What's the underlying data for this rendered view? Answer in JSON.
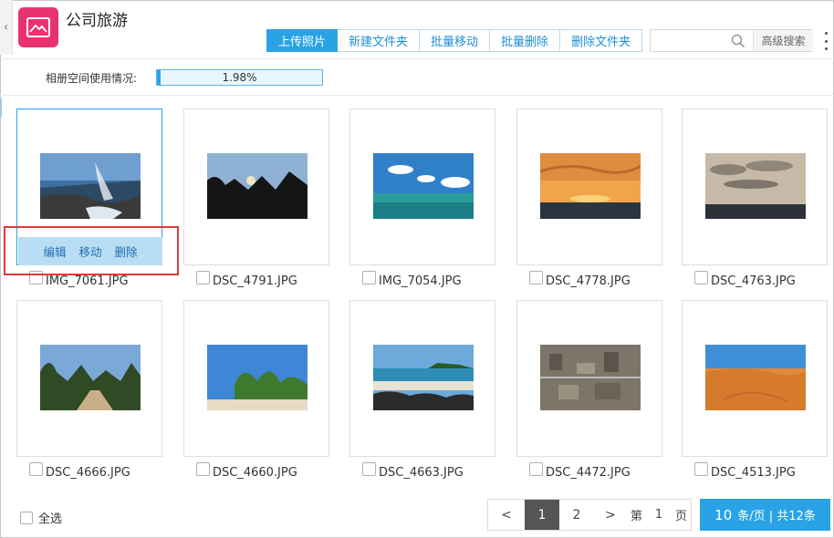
{
  "app": {
    "title": "公司旅游"
  },
  "toolbar": {
    "upload": "上传照片",
    "new_folder": "新建文件夹",
    "batch_move": "批量移动",
    "batch_delete": "批量删除",
    "delete_folder": "删除文件夹"
  },
  "search": {
    "placeholder": "",
    "advanced": "高级搜索"
  },
  "quota": {
    "label": "相册空间使用情况:",
    "percent_text": "1.98%",
    "percent_value": 1.98
  },
  "photo_actions": {
    "edit": "编辑",
    "move": "移动",
    "delete": "删除"
  },
  "photos": [
    {
      "name": "IMG_7061.JPG",
      "scene": "coast-waves"
    },
    {
      "name": "DSC_4791.JPG",
      "scene": "palm-sunset"
    },
    {
      "name": "IMG_7054.JPG",
      "scene": "sea-sky"
    },
    {
      "name": "DSC_4778.JPG",
      "scene": "orange-sunset"
    },
    {
      "name": "DSC_4763.JPG",
      "scene": "cloudy-dusk"
    },
    {
      "name": "DSC_4666.JPG",
      "scene": "palm-path"
    },
    {
      "name": "DSC_4660.JPG",
      "scene": "palm-blue"
    },
    {
      "name": "DSC_4663.JPG",
      "scene": "rocky-beach"
    },
    {
      "name": "DSC_4472.JPG",
      "scene": "city-aerial"
    },
    {
      "name": "DSC_4513.JPG",
      "scene": "desert"
    }
  ],
  "footer": {
    "select_all": "全选"
  },
  "pagination": {
    "prev": "<",
    "pages": [
      "1",
      "2"
    ],
    "current": "1",
    "next": ">",
    "goto_prefix": "第",
    "goto_page": "1",
    "goto_suffix": "页",
    "per_page": "10",
    "per_page_suffix": "条/页 | 共12条"
  },
  "colors": {
    "accent": "#2aa3e6",
    "app_icon": "#e8336f",
    "highlight": "#e23a3a"
  }
}
